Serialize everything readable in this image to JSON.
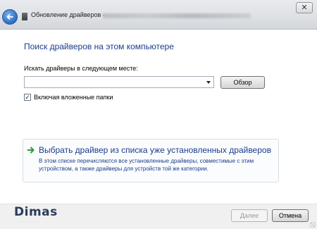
{
  "window": {
    "title": "Обновление драйверов -",
    "close_glyph": "✕"
  },
  "page": {
    "heading": "Поиск драйверов на этом компьютере",
    "search_label": "Искать драйверы в следующем месте:",
    "path_value": "",
    "browse_label": "Обзор",
    "include_subfolders": {
      "label": "Включая вложенные папки",
      "checked": true,
      "glyph": "✓"
    }
  },
  "choice": {
    "title": "Выбрать драйвер из списка уже установленных драйверов",
    "description": "В этом списке перечисляются все установленные драйверы, совместимые с этим устройством, а также драйверы для устройств той же категории.",
    "arrow_color": "#2f9a34"
  },
  "footer": {
    "next_label": "Далее",
    "cancel_label": "Отмена",
    "watermark": "Dimas"
  },
  "colors": {
    "link": "#1a3d8c",
    "titlebar": "#dfe2e6"
  },
  "icons": {
    "back": "back-arrow-icon",
    "choice": "green-arrow-icon",
    "combo": "chevron-down-icon"
  }
}
